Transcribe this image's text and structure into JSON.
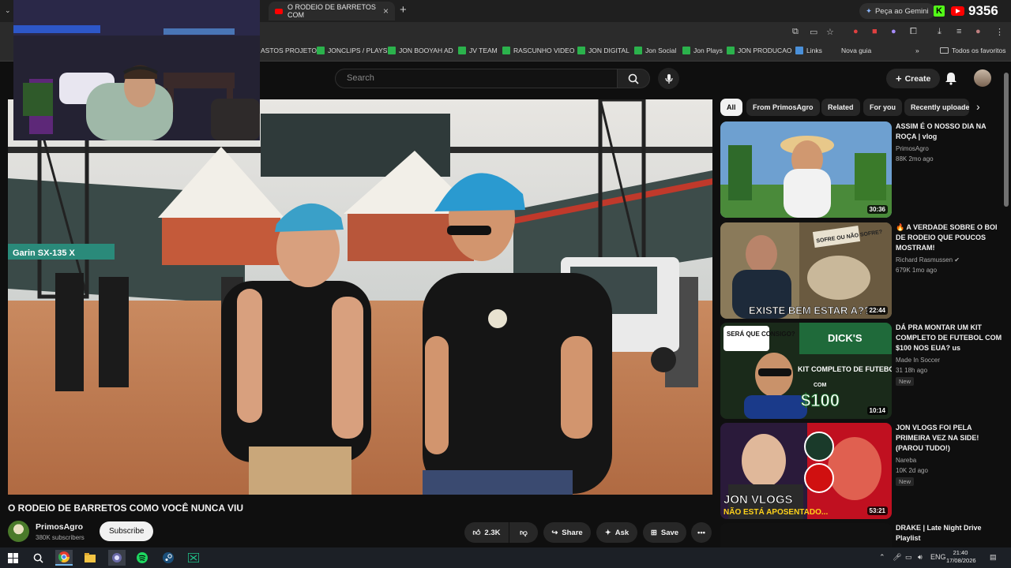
{
  "browser": {
    "tab_title": "O RODEIO DE BARRETOS COM",
    "new_tab": "+",
    "gemini": "Peça ao Gemini",
    "viewer_count": "9356"
  },
  "bookmarks": [
    {
      "label": "ASTOS PROJETO"
    },
    {
      "label": "JONCLIPS / PLAYS"
    },
    {
      "label": "JON BOOYAH AD"
    },
    {
      "label": "JV TEAM"
    },
    {
      "label": "RASCUNHO VIDEO"
    },
    {
      "label": "JON DIGITAL"
    },
    {
      "label": "Jon Social"
    },
    {
      "label": "Jon Plays"
    },
    {
      "label": "JON PRODUCAO"
    },
    {
      "label": "Links"
    },
    {
      "label": "Nova guia"
    }
  ],
  "bookmarks_more": "»",
  "favorites": "Todos os favoritos",
  "youtube": {
    "search_placeholder": "Search",
    "create": "Create"
  },
  "video": {
    "title": "O RODEIO DE BARRETOS COMO VOCÊ NUNCA VIU",
    "banner_text": "Garin SX-135 X",
    "channel": "PrimosAgro",
    "subscribers": "380K subscribers",
    "subscribe": "Subscribe",
    "likes": "2.3K",
    "share": "Share",
    "ask": "Ask",
    "save": "Save"
  },
  "chips": [
    {
      "label": "All"
    },
    {
      "label": "From PrimosAgro"
    },
    {
      "label": "Related"
    },
    {
      "label": "For you"
    },
    {
      "label": "Recently uploaded"
    }
  ],
  "recommendations": [
    {
      "title": "ASSIM É O NOSSO DIA NA ROÇA | vlog",
      "channel": "PrimosAgro",
      "meta": "88K   2mo ago",
      "duration": "30:36"
    },
    {
      "title": "🔥 A VERDADE SOBRE O BOI DE RODEIO QUE POUCOS MOSTRAM!",
      "channel": "Richard Rasmussen",
      "meta": "679K   1mo ago",
      "duration": "22:44",
      "thumb_text": "EXISTE BEM ESTAR A???",
      "thumb_text2": "SOFRE OU NÃO SOFRE?"
    },
    {
      "title": "DÁ PRA MONTAR UM KIT COMPLETO DE FUTEBOL COM $100 NOS EUA? us",
      "channel": "Made In Soccer",
      "meta": "31   18h ago",
      "badge": "New",
      "duration": "10:14",
      "thumb_text": "SERÁ QUE CONSIGO?",
      "thumb_text2": "KIT COMPLETO DE FUTEBOL",
      "thumb_price": "$100",
      "thumb_store": "DICK'S",
      "thumb_com": "COM"
    },
    {
      "title": "JON VLOGS FOI PELA PRIMEIRA VEZ NA SIDE! (PAROU TUDO!)",
      "channel": "Nareba",
      "meta": "10K   2d ago",
      "badge": "New",
      "duration": "53:21",
      "thumb_text": "JON VLOGS",
      "thumb_text2": "NÃO ESTÁ APOSENTADO..."
    },
    {
      "title": "DRAKE | Late Night Drive Playlist",
      "channel": "",
      "meta": "",
      "duration": ""
    }
  ],
  "taskbar": {
    "language": "ENG",
    "time": "21:40",
    "date": "17/08/2026"
  },
  "colors": {
    "youtube_red": "#ff0000",
    "kick_green": "#53fc18",
    "background": "#0f0f0f"
  }
}
